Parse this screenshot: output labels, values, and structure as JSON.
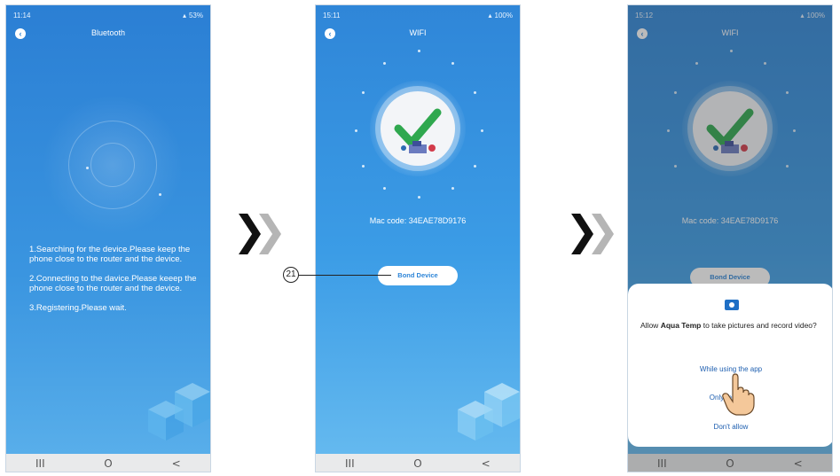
{
  "phone1": {
    "status": {
      "time": "11:14",
      "battery": "53%"
    },
    "title": "Bluetooth",
    "steps": [
      "1.Searching for the device.Please keep the phone close to the router and the device.",
      "2.Connecting to the davice.Please keeep the phone close to the router and the device.",
      "3.Registering.Please wait."
    ]
  },
  "phone2": {
    "status": {
      "time": "15:11",
      "battery": "100%"
    },
    "title": "WIFI",
    "mac_code": "Mac code: 34EAE78D9176",
    "bond_button": "Bond Device"
  },
  "phone3": {
    "status": {
      "time": "15:12",
      "battery": "100%"
    },
    "title": "WIFI",
    "mac_code": "Mac code: 34EAE78D9176",
    "bond_button": "Bond Device",
    "dialog": {
      "prefix": "Allow",
      "app_name": "Aqua Temp",
      "suffix": "to take pictures and record video?",
      "option_while_using": "While using the app",
      "option_only_this_time": "Only this time",
      "option_dont_allow": "Don't allow"
    }
  },
  "navbar": {
    "recent": "III",
    "home": "O",
    "back": "<"
  },
  "arrows": {
    "glyph": "❯"
  },
  "callout": {
    "number": "21"
  },
  "colors": {
    "accent": "#2f86d8",
    "check_green": "#2fa84f",
    "dialog_link": "#1e5fb0"
  }
}
